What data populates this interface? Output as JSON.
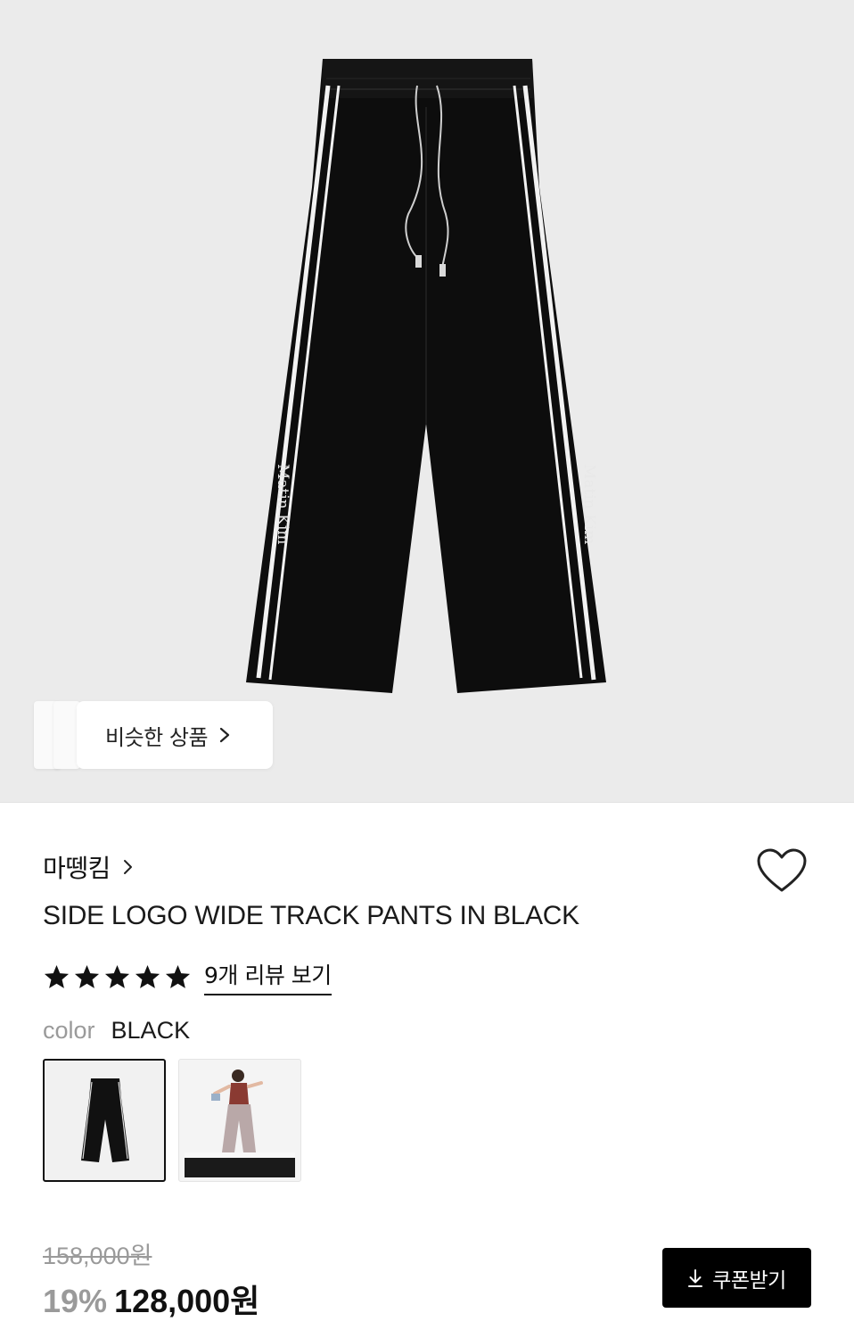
{
  "hero": {
    "similar_label": "비슷한 상품"
  },
  "product": {
    "brand": "마뗑킴",
    "title": "SIDE LOGO WIDE TRACK PANTS IN BLACK",
    "rating_stars": 5,
    "review_link": "9개 리뷰 보기",
    "color_label": "color",
    "color_value": "BLACK",
    "original_price": "158,000원",
    "discount": "19%",
    "price": "128,000원",
    "coupon_label": "쿠폰받기"
  },
  "colors": {
    "hero_bg": "#ebebeb",
    "product_black": "#0d0d0d",
    "accent": "#000000",
    "muted_text": "#9a9a9a"
  },
  "icons": [
    "chevron-right-icon",
    "heart-icon",
    "star-icon",
    "download-icon"
  ]
}
